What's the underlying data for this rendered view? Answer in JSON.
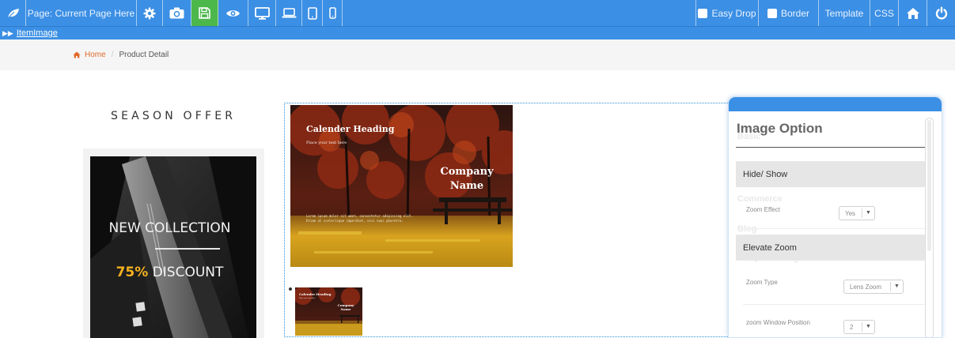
{
  "toolbar": {
    "page_label": "Page: Current Page Here",
    "easy_drop_label": "Easy Drop",
    "border_label": "Border",
    "template_label": "Template",
    "css_label": "CSS",
    "easy_drop_checked": false,
    "border_checked": false,
    "accent_color": "#3b8fe4",
    "save_color": "#4cb74b",
    "icons": [
      "leaf-icon",
      "gear-icon",
      "camera-icon",
      "save-icon",
      "eye-icon",
      "desktop-icon",
      "laptop-icon",
      "tablet-icon",
      "mobile-icon",
      "home-icon",
      "power-icon"
    ]
  },
  "item_bar": {
    "label": "ItemImage"
  },
  "breadcrumb": {
    "home": "Home",
    "separator": "/",
    "current": "Product Detail"
  },
  "left_column": {
    "heading": "SEASON OFFER",
    "promo_title": "NEW COLLECTION",
    "promo_percent": "75%",
    "promo_discount": " DISCOUNT"
  },
  "image": {
    "heading": "Calender Heading",
    "subtext": "Place your text here",
    "company": "Company Name",
    "lorem": "Lorem ipsum dolor sit amet, consectetur adipiscing elit. Etiam ut scelerisque imperdiet, nisi nunc pharetra."
  },
  "thumbnail": {
    "heading": "Calender Heading",
    "subtext": "Place your text here",
    "company": "Company Name"
  },
  "panel": {
    "title": "Image Option",
    "ghost_basic": "Basic",
    "ghost_commerce": "Commerce",
    "ghost_blog": "Blog",
    "ghost_widgets": "Template Widgets",
    "section_hide_show": "Hide/ Show",
    "zoom_effect_label": "Zoom Effect",
    "zoom_effect_value": "Yes",
    "section_elevate": "Elevate Zoom",
    "zoom_type_label": "Zoom Type",
    "zoom_type_value": "Lens Zoom",
    "zoom_window_label": "zoom Window Position",
    "zoom_window_value": "2"
  }
}
